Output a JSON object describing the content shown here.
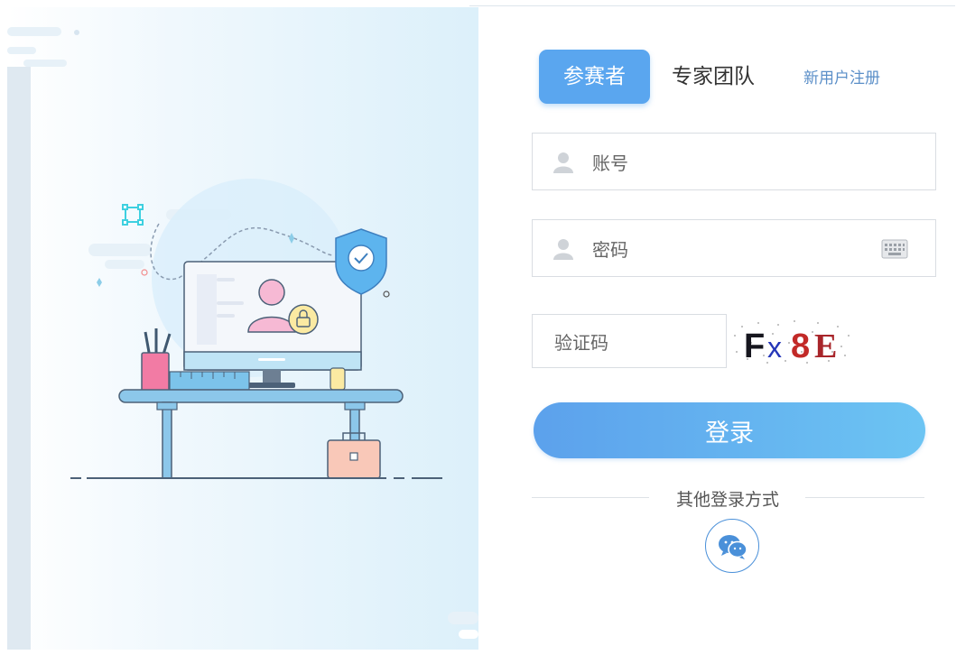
{
  "tabs": {
    "participant": "参赛者",
    "expert_team": "专家团队"
  },
  "register_link": "新用户注册",
  "account_field": {
    "placeholder": "账号",
    "icon": "user-icon"
  },
  "password_field": {
    "placeholder": "密码",
    "icon": "user-icon",
    "keyboard_icon": "keyboard-icon"
  },
  "captcha": {
    "placeholder": "验证码",
    "code": "Fx8E"
  },
  "login_button": "登录",
  "other_login": {
    "label": "其他登录方式",
    "wechat_icon": "wechat-icon"
  },
  "colors": {
    "accent": "#5aa6ef",
    "link": "#5b8fc8",
    "button_gradient_start": "#5ca1ec",
    "button_gradient_end": "#6cc4f3"
  }
}
